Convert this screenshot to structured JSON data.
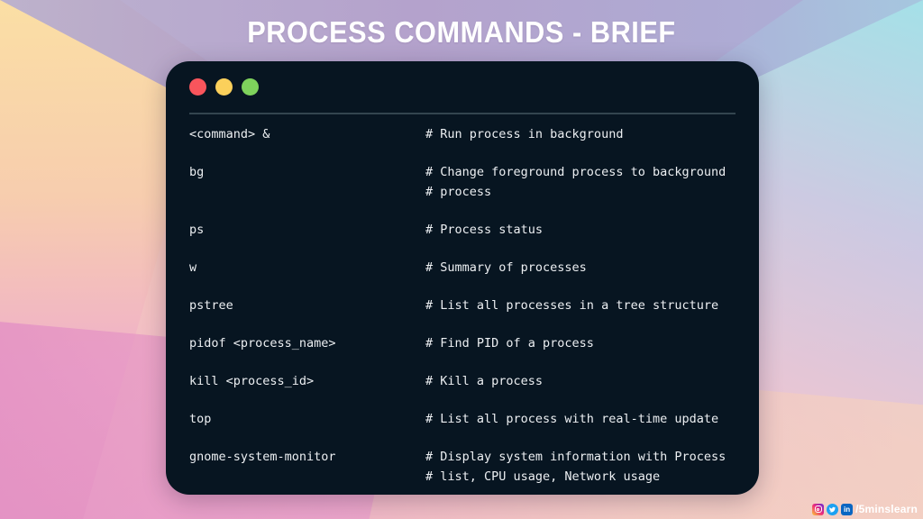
{
  "title": "PROCESS COMMANDS - BRIEF",
  "colors": {
    "terminal_bg": "#071521",
    "text": "#eceff2",
    "dot_red": "#f9555c",
    "dot_yellow": "#fbd05b",
    "dot_green": "#7ed25c",
    "separator": "#33454f",
    "title_text": "#ffffff"
  },
  "terminal": {
    "buttons": [
      {
        "name": "close",
        "color": "#f9555c"
      },
      {
        "name": "minimize",
        "color": "#fbd05b"
      },
      {
        "name": "maximize",
        "color": "#7ed25c"
      }
    ],
    "rows": [
      {
        "command": "<command> &",
        "comment_lines": [
          "# Run process in background"
        ]
      },
      {
        "command": "bg",
        "comment_lines": [
          "# Change foreground process to background",
          "# process"
        ]
      },
      {
        "command": "ps",
        "comment_lines": [
          "# Process status"
        ]
      },
      {
        "command": "w",
        "comment_lines": [
          "# Summary of processes"
        ]
      },
      {
        "command": "pstree",
        "comment_lines": [
          "# List all processes in a tree structure"
        ]
      },
      {
        "command": "pidof <process_name>",
        "comment_lines": [
          "# Find PID of a process"
        ]
      },
      {
        "command": "kill <process_id>",
        "comment_lines": [
          "# Kill a process"
        ]
      },
      {
        "command": "top",
        "comment_lines": [
          "# List all process with real-time update"
        ]
      },
      {
        "command": "gnome-system-monitor",
        "comment_lines": [
          "# Display system information with Process",
          "# list, CPU usage, Network usage"
        ]
      }
    ]
  },
  "watermark": {
    "handle": "/5minslearn",
    "icons": [
      "instagram-icon",
      "twitter-icon",
      "linkedin-icon"
    ],
    "linkedin_label": "in"
  }
}
